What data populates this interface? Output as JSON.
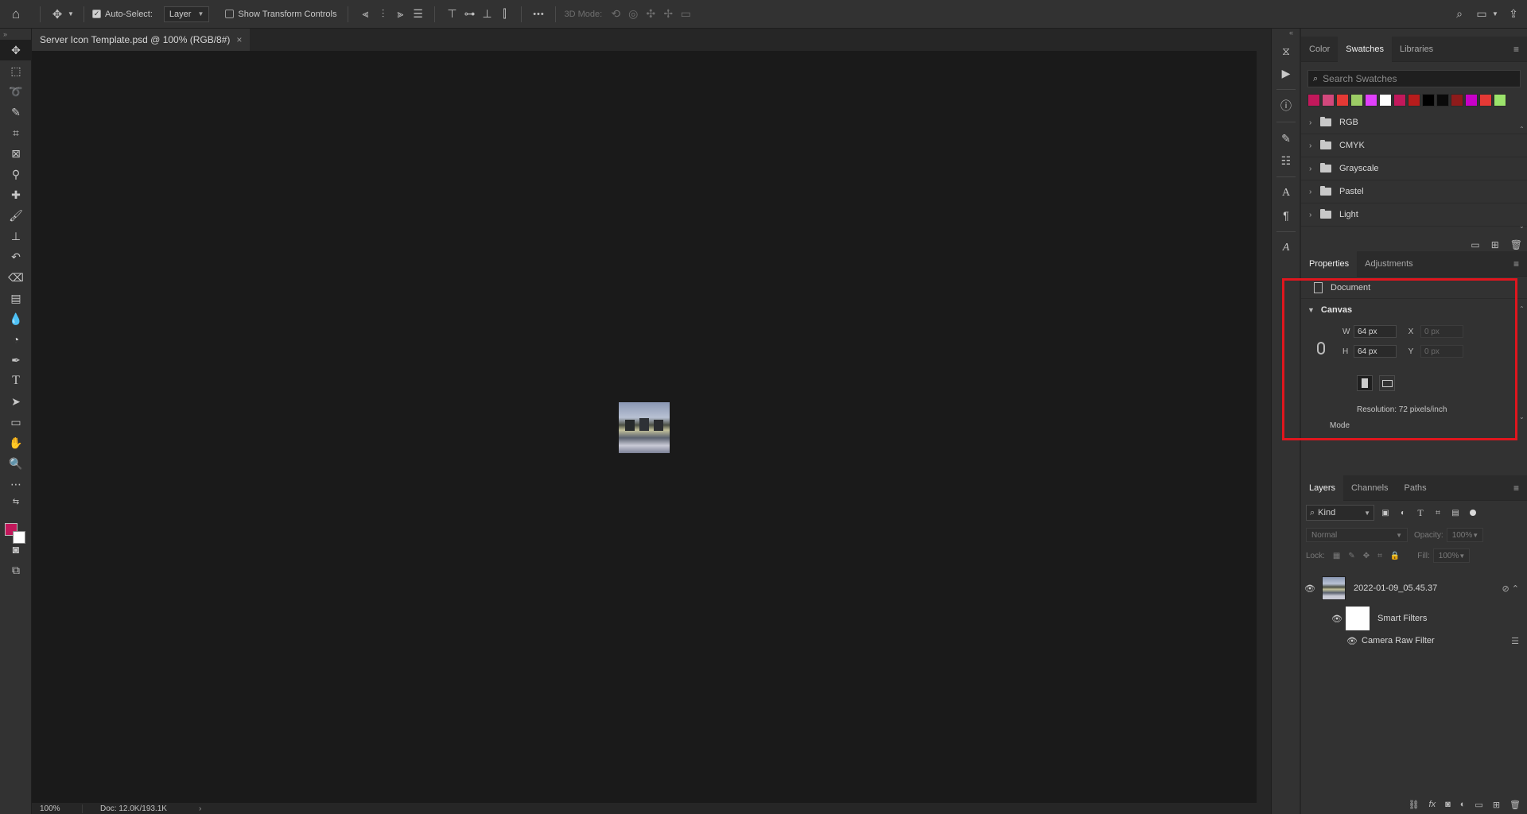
{
  "optionsBar": {
    "autoSelectLabel": "Auto-Select:",
    "autoSelectTarget": "Layer",
    "showTransformLabel": "Show Transform Controls",
    "threeDModeLabel": "3D Mode:",
    "moreGlyph": "•••"
  },
  "document": {
    "tabTitle": "Server Icon Template.psd @ 100% (RGB/8#)",
    "closeGlyph": "×"
  },
  "status": {
    "zoom": "100%",
    "docSize": "Doc: 12.0K/193.1K",
    "arrowGlyph": "›"
  },
  "swatchesPanel": {
    "tabs": [
      "Color",
      "Swatches",
      "Libraries"
    ],
    "searchPlaceholder": "Search Swatches",
    "colors": [
      "#c2185b",
      "#d2487c",
      "#e53935",
      "#9ccc65",
      "#e040fb",
      "#ffffff",
      "#c2185b",
      "#b71c1c",
      "#000000",
      "#0a0a0a",
      "#8e1b1b",
      "#c800c8",
      "#e53935",
      "#9be36b"
    ],
    "groups": [
      "RGB",
      "CMYK",
      "Grayscale",
      "Pastel",
      "Light"
    ]
  },
  "propertiesPanel": {
    "tabs": [
      "Properties",
      "Adjustments"
    ],
    "documentLabel": "Document",
    "canvasHeader": "Canvas",
    "wLabel": "W",
    "wValue": "64 px",
    "hLabel": "H",
    "hValue": "64 px",
    "xLabel": "X",
    "xValue": "0 px",
    "yLabel": "Y",
    "yValue": "0 px",
    "resolution": "Resolution: 72 pixels/inch",
    "modeLabel": "Mode"
  },
  "layersPanel": {
    "tabs": [
      "Layers",
      "Channels",
      "Paths"
    ],
    "kindFilter": "Kind",
    "blendMode": "Normal",
    "opacityLabel": "Opacity:",
    "opacityValue": "100%",
    "lockLabel": "Lock:",
    "fillLabel": "Fill:",
    "fillValue": "100%",
    "layers": [
      {
        "name": "2022-01-09_05.45.37"
      },
      {
        "name": "Smart Filters"
      },
      {
        "name": "Camera Raw Filter"
      }
    ]
  },
  "colors": {
    "foreground": "#c2185b",
    "background": "#ffffff",
    "highlight": "#e0161e"
  }
}
